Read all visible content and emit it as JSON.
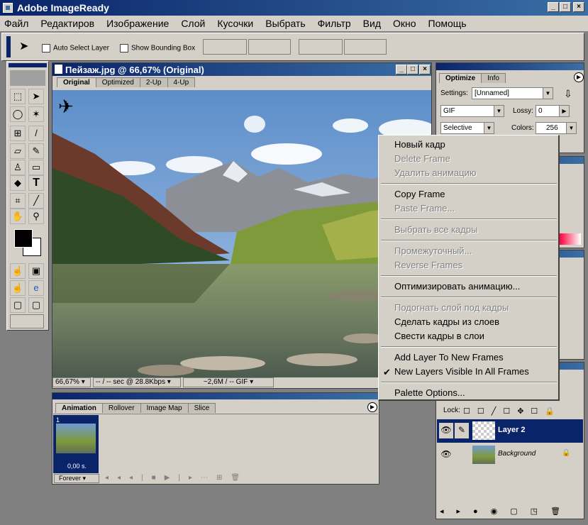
{
  "app": {
    "title": "Adobe ImageReady"
  },
  "menu": [
    "Файл",
    "Редактиров",
    "Изображение",
    "Слой",
    "Кусочки",
    "Выбрать",
    "Фильтр",
    "Вид",
    "Окно",
    "Помощь"
  ],
  "options": {
    "auto_select": "Auto Select Layer",
    "show_bbox": "Show Bounding Box"
  },
  "document": {
    "title": "Пейзаж.jpg @ 66,67% (Original)",
    "tabs": [
      "Original",
      "Optimized",
      "2-Up",
      "4-Up"
    ],
    "zoom": "66,67%",
    "status1": "-- / -- sec @ 28.8Kbps",
    "status2": "~2,6M / -- GIF"
  },
  "animation": {
    "tabs": [
      "Animation",
      "Rollover",
      "Image Map",
      "Slice"
    ],
    "frame_number": "1",
    "frame_delay": "0,00 s.",
    "loop": "Forever"
  },
  "optimize": {
    "tabs": [
      "Optimize",
      "Info"
    ],
    "settings_label": "Settings:",
    "settings_value": "[Unnamed]",
    "format": "GIF",
    "lossy_label": "Lossy:",
    "lossy_value": "0",
    "palette": "Selective",
    "colors_label": "Colors:",
    "colors_value": "256"
  },
  "layers": {
    "lock_label": "Lock:",
    "items": [
      {
        "name": "Layer 2"
      },
      {
        "name": "Background"
      }
    ]
  },
  "context_menu": [
    {
      "label": "Новый кадр",
      "enabled": true
    },
    {
      "label": "Delete Frame",
      "enabled": false
    },
    {
      "label": "Удалить анимацию",
      "enabled": false
    },
    {
      "sep": true
    },
    {
      "label": "Copy Frame",
      "enabled": true
    },
    {
      "label": "Paste Frame...",
      "enabled": false
    },
    {
      "sep": true
    },
    {
      "label": "Выбрать все кадры",
      "enabled": false
    },
    {
      "sep": true
    },
    {
      "label": "Промежуточный...",
      "enabled": false
    },
    {
      "label": "Reverse Frames",
      "enabled": false
    },
    {
      "sep": true
    },
    {
      "label": "Оптимизировать анимацию...",
      "enabled": true
    },
    {
      "sep": true
    },
    {
      "label": "Подогнать слой под кадры",
      "enabled": false
    },
    {
      "label": "Сделать кадры из слоев",
      "enabled": true
    },
    {
      "label": "Свести кадры в слои",
      "enabled": true
    },
    {
      "sep": true
    },
    {
      "label": "Add Layer To New Frames",
      "enabled": true
    },
    {
      "label": "New Layers Visible In All Frames",
      "enabled": true,
      "checked": true
    },
    {
      "sep": true
    },
    {
      "label": "Palette Options...",
      "enabled": true
    }
  ]
}
